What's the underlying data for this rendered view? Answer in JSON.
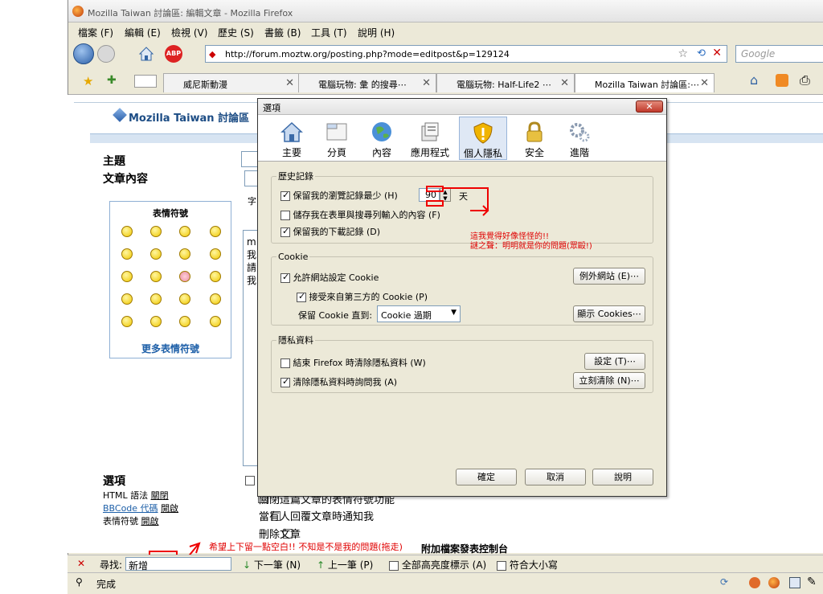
{
  "window": {
    "title": "Mozilla Taiwan 討論區: 編輯文章 - Mozilla Firefox"
  },
  "menu": [
    "檔案 (F)",
    "編輯 (E)",
    "檢視 (V)",
    "歷史 (S)",
    "書籤 (B)",
    "工具 (T)",
    "說明 (H)"
  ],
  "nav": {
    "url": "http://forum.moztw.org/posting.php?mode=editpost&p=129124",
    "search_placeholder": "Google"
  },
  "tabs": [
    "威尼斯動漫",
    "電腦玩物: 彙 的搜尋⋯",
    "電腦玩物: Half-Life2 ⋯",
    "Mozilla Taiwan 討論區:⋯"
  ],
  "page": {
    "forum_title": "Mozilla Taiwan 討論區",
    "subject_label": "主題",
    "body_label": "文章內容",
    "emoticons_title": "表情符號",
    "more_emoticons": "更多表情符號",
    "options_title": "選項",
    "html_label": "HTML 語法",
    "html_value": "關閉",
    "bbcode_label": "BBCode 代碼",
    "bbcode_value": "開啟",
    "smilies_label": "表情符號",
    "smilies_value": "開啟",
    "opt_notify": "當有人回覆文章時通知我",
    "opt_delete": "刪除文章",
    "opt_partial": "關閉這篇文章的表情符號功能",
    "attach_partial": "附加檔案發表控制台",
    "textarea_chars": [
      "m",
      "我",
      "請",
      "我"
    ],
    "char_hint": "字"
  },
  "annotation": {
    "note1": "這我覺得好像怪怪的!!",
    "note2": "謎之聲：明明就是你的問題(眾毆!)",
    "note3": "希望上下留一點空白!! 不知是不是我的問題(拖走)"
  },
  "findbar": {
    "label": "尋找:",
    "value": "新增",
    "next": "下一筆 (N)",
    "prev": "上一筆 (P)",
    "highlight": "全部高亮度標示 (A)",
    "match_case": "符合大小寫"
  },
  "status": {
    "text": "完成"
  },
  "dialog": {
    "title": "選項",
    "panes": [
      "主要",
      "分頁",
      "內容",
      "應用程式",
      "個人隱私",
      "安全",
      "進階"
    ],
    "history": {
      "legend": "歷史記錄",
      "keep_history": "保留我的瀏覽記錄最少 (H)",
      "days_value": "90",
      "days_unit": "天",
      "save_form": "儲存我在表單與搜尋列輸入的內容 (F)",
      "keep_downloads": "保留我的下載記錄 (D)"
    },
    "cookie": {
      "legend": "Cookie",
      "allow": "允許網站設定 Cookie",
      "exceptions": "例外網站 (E)⋯",
      "third_party": "接受來自第三方的 Cookie (P)",
      "keep_until_label": "保留 Cookie 直到:",
      "keep_until_value": "Cookie 過期",
      "show": "顯示 Cookies⋯"
    },
    "private": {
      "legend": "隱私資料",
      "clear_on_close": "結束 Firefox 時清除隱私資料 (W)",
      "settings": "設定 (T)⋯",
      "ask": "清除隱私資料時詢問我 (A)",
      "clear_now": "立刻清除 (N)⋯"
    },
    "ok": "確定",
    "cancel": "取消",
    "help": "說明"
  }
}
